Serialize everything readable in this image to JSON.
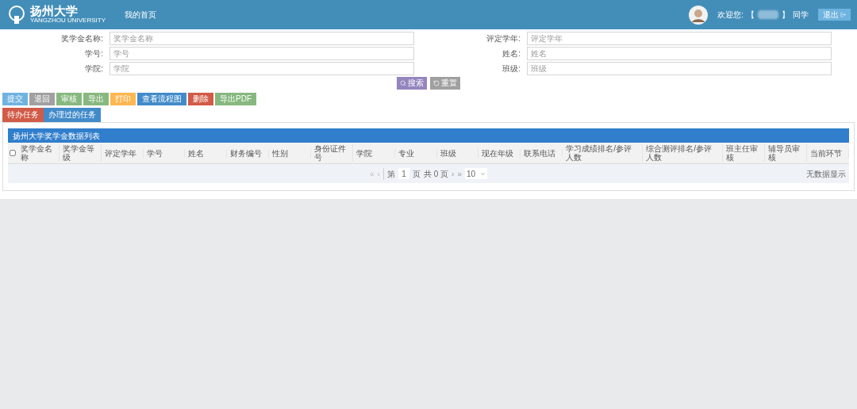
{
  "header": {
    "logo_text": "扬州大学",
    "logo_subtext": "YANGZHOU UNIVERSITY",
    "nav": "我的首页",
    "welcome": "欢迎您:",
    "bracket_open": "【",
    "bracket_close": "】",
    "user_suffix": "同学",
    "logout": "退出"
  },
  "search_form": {
    "fields": [
      {
        "label": "奖学金名称:",
        "placeholder": "奖学金名称"
      },
      {
        "label": "评定学年:",
        "placeholder": "评定学年"
      },
      {
        "label": "学号:",
        "placeholder": "学号"
      },
      {
        "label": "姓名:",
        "placeholder": "姓名"
      },
      {
        "label": "学院:",
        "placeholder": "学院"
      },
      {
        "label": "班级:",
        "placeholder": "班级"
      }
    ],
    "buttons": [
      {
        "label": "搜索",
        "kind": "search"
      },
      {
        "label": "重置",
        "kind": "reset"
      }
    ]
  },
  "toolbar": [
    {
      "label": "提交",
      "color": "#6fb3e0"
    },
    {
      "label": "退回",
      "color": "#a0a0a0"
    },
    {
      "label": "审核",
      "color": "#87b87f"
    },
    {
      "label": "导出",
      "color": "#87b87f"
    },
    {
      "label": "打印",
      "color": "#ffb752"
    },
    {
      "label": "查看流程图",
      "color": "#428bca"
    },
    {
      "label": "删除",
      "color": "#d15b47"
    },
    {
      "label": "导出PDF",
      "color": "#87b87f"
    }
  ],
  "tabs": [
    {
      "label": "待办任务",
      "selected": true
    },
    {
      "label": "办理过的任务",
      "selected": false
    }
  ],
  "table": {
    "title": "扬州大学奖学金数据列表",
    "select_all_checked": false,
    "columns": [
      "奖学金名称",
      "奖学金等级",
      "评定学年",
      "学号",
      "姓名",
      "财务编号",
      "性别",
      "身份证件号",
      "学院",
      "专业",
      "班级",
      "现在年级",
      "联系电话",
      "学习成绩排名/参评人数",
      "综合测评排名/参评人数",
      "班主任审核",
      "辅导员审核",
      "当前环节"
    ]
  },
  "pagination": {
    "first": "«",
    "prev": "‹",
    "page_label": "第",
    "page": "1",
    "page_unit": "页",
    "total": "共 0 页",
    "next": "›",
    "last": "»",
    "page_size": "10",
    "empty": "无数据显示"
  }
}
